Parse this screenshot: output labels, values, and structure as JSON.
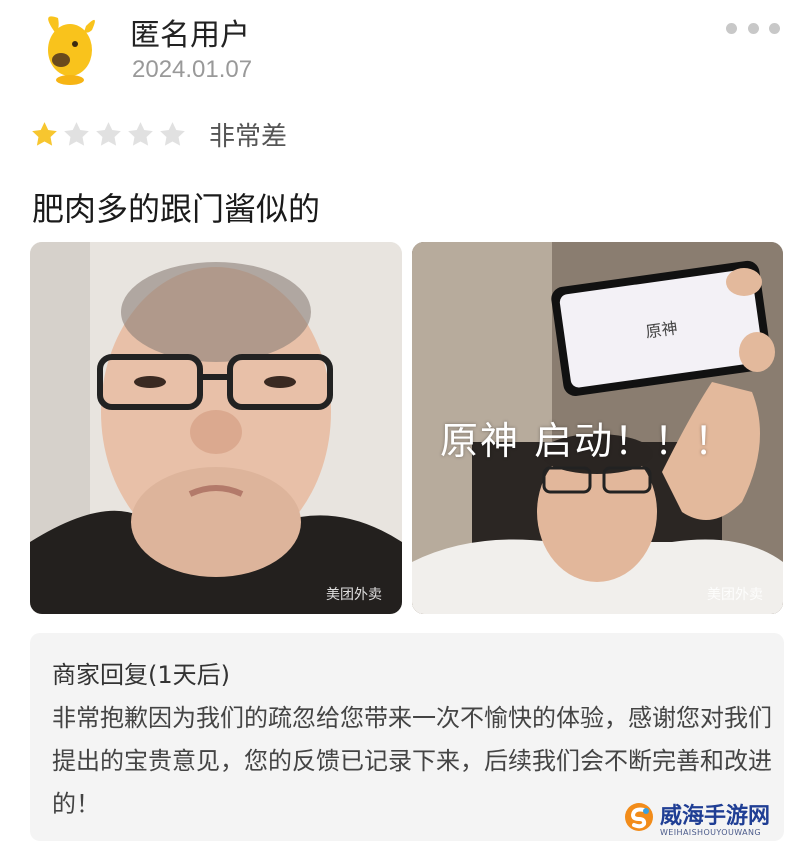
{
  "review": {
    "user_name": "匿名用户",
    "date": "2024.01.07",
    "rating": {
      "value": 1,
      "max": 5,
      "label": "非常差"
    },
    "text": "肥肉多的跟门酱似的",
    "avatar_icon": "yellow-dog-avatar",
    "more_icon": "more-dots-icon"
  },
  "photos": [
    {
      "name": "review-photo-1",
      "watermark": "美团外卖"
    },
    {
      "name": "review-photo-2",
      "caption": "原神 启动！！！",
      "phone_screen_text": "原神",
      "watermark": "美团外卖"
    }
  ],
  "merchant_reply": {
    "title": "商家回复(1天后)",
    "body": "非常抱歉因为我们的疏忽给您带来一次不愉快的体验，感谢您对我们提出的宝贵意见，您的反馈已记录下来，后续我们会不断完善和改进的！"
  },
  "site_watermark": {
    "title": "威海手游网",
    "subtitle": "WEIHAISHOUYOUWANG"
  },
  "colors": {
    "star_active": "#f7c62f",
    "star_inactive": "#e1e1e1",
    "reply_bg": "#f4f4f4",
    "watermark_blue": "#1f3e94"
  }
}
